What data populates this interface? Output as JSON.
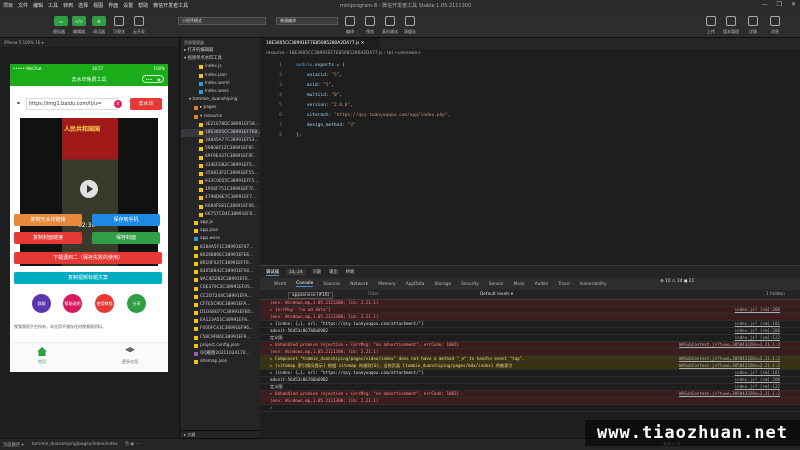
{
  "menu": [
    "项目",
    "文件",
    "编辑",
    "工具",
    "转到",
    "选择",
    "视图",
    "界面",
    "设置",
    "帮助",
    "微信开发者工具"
  ],
  "window_title": "miniprogram-8 - 微信开发者工具 Stable 1.05.2111300",
  "window_controls": [
    "—",
    "❐",
    "✕"
  ],
  "toolbar": {
    "simulator": "模拟器",
    "editor": "编辑器",
    "debugger": "调试器",
    "visual": "可视化",
    "cloud": "云开发",
    "mode_select": "小程序模式",
    "compile_select": "普通编译",
    "compile": "编译",
    "preview": "预览",
    "real_debug": "真机调试",
    "clear_cache": "清缓存",
    "upload": "上传",
    "version": "版本管理",
    "details": "详情",
    "messages": "消息"
  },
  "simulator_header": "iPhone 5 100% 16 ▾",
  "phone": {
    "carrier": "••••• WeChat",
    "time": "16:57",
    "battery": "100%",
    "nav_title": "去水印免费工具",
    "url_value": "https://img1.baidu.com/it/u=",
    "parse_button": "去水印",
    "video_title": "人民共和国国",
    "video_time": "02:30",
    "buttons": {
      "copy_link": "复制无水印链接",
      "save_album": "保存到手机",
      "copy_img_link": "复制封面链接",
      "save_cover": "保存封面",
      "download_video": "下载遇到二（保存失败的使用）",
      "copy_title": "复制视频标题文案"
    },
    "circles": [
      "群聊",
      "帮助说明",
      "使用教程",
      "分享"
    ],
    "notice": "视频版权平台所有，本应用不储存任何视频和资料。",
    "tabs": [
      "首页",
      "更多应用"
    ]
  },
  "tree_header": "资源管理器",
  "tree": [
    {
      "t": "▸ 打开的编辑器",
      "i": 0
    },
    {
      "t": "▾ 视频单点水印工具",
      "i": 0
    },
    {
      "t": "index.js",
      "i": 3,
      "c": "#f1c40f"
    },
    {
      "t": "index.json",
      "i": 3,
      "c": "#f1c40f"
    },
    {
      "t": "index.wxml",
      "i": 3,
      "c": "#3498db"
    },
    {
      "t": "index.wxss",
      "i": 3,
      "c": "#3498db"
    },
    {
      "t": "▾ tommie_duanshiping",
      "i": 1
    },
    {
      "t": "▸ pages",
      "i": 2,
      "c": "#e67e22"
    },
    {
      "t": "▾ resource",
      "i": 2,
      "c": "#e67e22"
    },
    {
      "t": "3E21078DC38991EF58...",
      "i": 3,
      "c": "#f1c40f"
    },
    {
      "t": "18E3605CC38991EF7E8...",
      "i": 3,
      "c": "#f1c40f",
      "sel": true
    },
    {
      "t": "34845A77C38991EF53...",
      "i": 3,
      "c": "#f1c40f"
    },
    {
      "t": "59808F12C38991EF6F...",
      "i": 3,
      "c": "#f1c40f"
    },
    {
      "t": "69F9E437C38991EF0F...",
      "i": 3,
      "c": "#f1c40f"
    },
    {
      "t": "334EFD82C38991EF5...",
      "i": 3,
      "c": "#f1c40f"
    },
    {
      "t": "356813F2C38991EF55...",
      "i": 3,
      "c": "#f1c40f"
    },
    {
      "t": "933C0055C38991EFF5...",
      "i": 3,
      "c": "#f1c40f"
    },
    {
      "t": "1956F751C38991EF7F...",
      "i": 3,
      "c": "#f1c40f"
    },
    {
      "t": "4798D6E7C38991EF7...",
      "i": 3,
      "c": "#f1c40f"
    },
    {
      "t": "6084FE81C38991EF06...",
      "i": 3,
      "c": "#f1c40f"
    },
    {
      "t": "66757CD4C38991EF0...",
      "i": 3,
      "c": "#f1c40f"
    },
    {
      "t": "app.js",
      "i": 2,
      "c": "#f1c40f"
    },
    {
      "t": "app.json",
      "i": 2,
      "c": "#f1c40f"
    },
    {
      "t": "app.wxss",
      "i": 2,
      "c": "#3498db"
    },
    {
      "t": "8184A5F1C38991EF07...",
      "i": 2,
      "c": "#f1c40f"
    },
    {
      "t": "8026880EC38991EFE6...",
      "i": 2,
      "c": "#f1c40f"
    },
    {
      "t": "8610F437C38991EFF0...",
      "i": 2,
      "c": "#f1c40f"
    },
    {
      "t": "83058842C38991EF00...",
      "i": 2,
      "c": "#f1c40f"
    },
    {
      "t": "8AC4D2B2C38991EF0...",
      "i": 2,
      "c": "#f1c40f"
    },
    {
      "t": "C6E379C2C38991EF05...",
      "i": 2,
      "c": "#f1c40f"
    },
    {
      "t": "CC2D7244C38991EFA...",
      "i": 2,
      "c": "#f1c40f"
    },
    {
      "t": "CFFE5C90C38991EFA...",
      "i": 2,
      "c": "#f1c40f"
    },
    {
      "t": "D1D68077C38991EFB0...",
      "i": 2,
      "c": "#f1c40f"
    },
    {
      "t": "EA123A51C38991EF8...",
      "i": 2,
      "c": "#f1c40f"
    },
    {
      "t": "F000FC43C38991EF96...",
      "i": 2,
      "c": "#f1c40f"
    },
    {
      "t": "F58C9FB6C38991EF9...",
      "i": 2,
      "c": "#f1c40f"
    },
    {
      "t": "project.config.json",
      "i": 2,
      "c": "#f1c40f"
    },
    {
      "t": "QQ截图20211024170...",
      "i": 2,
      "c": "#9b59b6"
    },
    {
      "t": "sitemap.json",
      "i": 2,
      "c": "#f1c40f"
    }
  ],
  "outline": "▸ 大纲",
  "editor": {
    "tab": "18E3605CC38991EF7E85085280A2DA77.js ✕",
    "breadcrumb": "resource ›  18E3605CC38991EF7E85085280A2DA77.js › [ø] <unknown>",
    "lines": [
      {
        "n": "1",
        "parts": [
          [
            "kw",
            "module"
          ],
          [
            "pun",
            "."
          ],
          [
            "prop",
            "exports"
          ],
          [
            "pun",
            " = {"
          ]
        ]
      },
      {
        "n": "2",
        "parts": [
          [
            "prop",
            "    uniacid"
          ],
          [
            "pun",
            ": "
          ],
          [
            "str",
            "\"5\""
          ],
          [
            "pun",
            ","
          ]
        ]
      },
      {
        "n": "3",
        "parts": [
          [
            "prop",
            "    acid"
          ],
          [
            "pun",
            ": "
          ],
          [
            "str",
            "\"5\""
          ],
          [
            "pun",
            ","
          ]
        ]
      },
      {
        "n": "4",
        "parts": [
          [
            "prop",
            "    multiid"
          ],
          [
            "pun",
            ": "
          ],
          [
            "str",
            "\"0\""
          ],
          [
            "pun",
            ","
          ]
        ]
      },
      {
        "n": "5",
        "parts": [
          [
            "prop",
            "    version"
          ],
          [
            "pun",
            ": "
          ],
          [
            "str",
            "\"2.0.0\""
          ],
          [
            "pun",
            ","
          ]
        ]
      },
      {
        "n": "6",
        "parts": [
          [
            "prop",
            "    siteroot"
          ],
          [
            "pun",
            ": "
          ],
          [
            "str",
            "\"https://qsy.tuanyuqqou.com/app/index.php\""
          ],
          [
            "pun",
            ","
          ]
        ]
      },
      {
        "n": "7",
        "parts": [
          [
            "prop",
            "    design_method"
          ],
          [
            "pun",
            ": "
          ],
          [
            "str",
            "\"3\""
          ]
        ]
      },
      {
        "n": "8",
        "parts": [
          [
            "pun",
            "};"
          ]
        ]
      }
    ]
  },
  "devtools": {
    "top_tabs": [
      "调试器",
      "10, 24",
      "问题",
      "输出",
      "终端"
    ],
    "panels": [
      "Wxml",
      "Console",
      "Sources",
      "Network",
      "Memory",
      "AppData",
      "Storage",
      "Security",
      "Sensor",
      "Mock",
      "Audits",
      "Trace",
      "Vulnerability"
    ],
    "counts": "⊗ 10  ⚠ 24  ◼ 21",
    "context": "appservice (#16)",
    "filter": "Filter",
    "levels": "Default levels ▾",
    "hidden": "1 hidden",
    "rows": [
      {
        "k": "err",
        "t": "(env: Windows,mp,1.05.2111300; lib: 2.21.1)",
        "s": ""
      },
      {
        "k": "err",
        "t": "▸ {errMsg: \"no ad data\"}",
        "s": "index.js? [sm]:206"
      },
      {
        "k": "err",
        "t": "(env: Windows,mp,1.05.2111300; lib: 2.21.1)",
        "s": ""
      },
      {
        "k": "",
        "t": "▸ {index: {…}, url: \"https://qsy.tuanyuqqou.com/attachment/\"}",
        "s": "index.js? [sm]:181"
      },
      {
        "k": "",
        "t": "adunit-56453c06766b6982",
        "s": "index.js? [sm]:208"
      },
      {
        "k": "",
        "t": "定义图",
        "s": "index.js? [sm]:122"
      },
      {
        "k": "err",
        "t": "▸ Unhandled promise rejection ▸ {errMsg: \"no advertisement\", errCode: 1002}",
        "s": "WASubContext.js?t=we…305843328v=2.21.1:2"
      },
      {
        "k": "err",
        "t": "(env: Windows,mp,1.05.2111300; lib: 2.21.1)",
        "s": ""
      },
      {
        "k": "warn",
        "t": "▸ Component \"tommie_duanshiping/pages/video/index\" does not have a method \"_e\" to handle event \"tap\".",
        "s": "WASubContext.js?t=we…305843328v=2.21.1:2"
      },
      {
        "k": "warn",
        "t": "▸ [sitemap 索引情况提示] 根据 sitemap 的规则[0]，当前页面 [tommie_duanshiping/pages/mdx/index] 将被索引",
        "s": "WASubContext.js?t=we…305843328v=2.21.1:2"
      },
      {
        "k": "",
        "t": "▸ {index: {…}, url: \"https://qsy.tuanyuqqou.com/attachment/\"}",
        "s": "index.js? [sm]:181"
      },
      {
        "k": "",
        "t": "adunit-56453c06766b6982",
        "s": "index.js? [sm]:208"
      },
      {
        "k": "",
        "t": "定义图",
        "s": "index.js? [sm]:122"
      },
      {
        "k": "err",
        "t": "▸ Unhandled promise rejection ▸ {errMsg: \"no advertisement\", errCode: 1002}",
        "s": "WASubContext.js?t=we…305843328v=2.21.1:2"
      },
      {
        "k": "err",
        "t": "(env: Windows,mp,1.05.2111300; lib: 2.21.1)",
        "s": ""
      },
      {
        "k": "",
        "t": "›",
        "s": ""
      }
    ]
  },
  "statusbar": {
    "path_label": "页面路径 ▾",
    "path": "tommie_duanshiping/pages/index/index",
    "icons": "⎘ ◉ ⋯",
    "right": "⊗ 0 ⚠ 0"
  },
  "watermark": "www.tiaozhuan.net",
  "colors": {
    "green": "#1aad19",
    "red": "#e53935",
    "orange": "#e8883a",
    "blue": "#1e88e5",
    "cyan": "#00acc1",
    "purple": "#5e35b1",
    "pink": "#d81b60",
    "tabgreen": "#2f9e44"
  }
}
